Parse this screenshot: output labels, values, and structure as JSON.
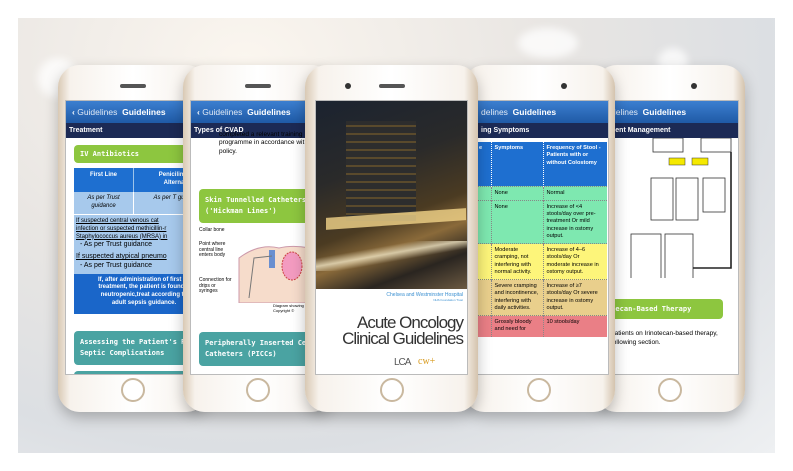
{
  "nav": {
    "back_label": "Guidelines",
    "title": "Guidelines"
  },
  "phone1": {
    "section": "Treatment",
    "heading": "IV Antibiotics",
    "table": {
      "headers": [
        "First Line",
        "Penicilin A",
        "Alterna"
      ],
      "row1": [
        "As per Trust guidance",
        "As per T guidar"
      ],
      "note1": [
        "If suspected central venous cat",
        "infection or suspected methicillin-r",
        "Staphylococcus aureus (MRSA) in"
      ],
      "note1_tail": "- As per Trust guidance",
      "note2": "If suspected atypical pneumo",
      "note2_tail": "- As per Trust guidance",
      "footer": [
        "If, after administration of first an",
        "treatment, the patient is found n",
        "neutropenic,treat according to",
        "adult sepsis guidance."
      ]
    },
    "next_section": [
      "Assessing the Patient's Risk",
      "Septic Complications"
    ]
  },
  "phone2": {
    "section": "Types of CVAD",
    "intro": [
      "completed a relevant training",
      "programme in accordance wit",
      "policy."
    ],
    "heading": [
      "Skin Tunnelled Catheters",
      "('Hickman Lines')"
    ],
    "diagram_labels": [
      "Collar bone",
      "Point where central line enters body",
      "Connection for drips or syringes"
    ],
    "caption": [
      "Diagram showing",
      "Copyright ©"
    ],
    "next_section": [
      "Peripherally Inserted Centr",
      "Catheters (PICCs)"
    ]
  },
  "phone3": {
    "hospital": "Chelsea and Westminster Hospital",
    "trust": "NHS Foundation Trust",
    "title_line1": "Acute Oncology",
    "title_line2": "Clinical Guidelines",
    "logo_lca": "LCA",
    "logo_cw": "cw+"
  },
  "phone4": {
    "nav_fragment": "delines",
    "section": "ing Symptoms",
    "headers": [
      "e",
      "Symptoms",
      "Frequency of Stool - Patients with or without Colostomy"
    ],
    "rows": [
      {
        "symptoms": "None",
        "frequency": "Normal",
        "color": "#7ee8b0"
      },
      {
        "symptoms": "None",
        "frequency": "Increase of <4 stools/day over pre-treatment Or mild increase in ostomy output.",
        "color": "#7ee8b0"
      },
      {
        "symptoms": "Moderate cramping, not interfering with normal activity.",
        "frequency": "Increase of 4–6 stools/day Or moderate increase in ostomy output.",
        "color": "#fdf57a"
      },
      {
        "symptoms": "Severe cramping and incontinence, interfering with daily activities.",
        "frequency": "Increase of ≥7 stools/day Or severe increase in ostomy output.",
        "color": "#e9cf8c"
      },
      {
        "symptoms": "Grossly bloody and need for",
        "frequency": "10 stools/day",
        "color": "#ea7f86"
      }
    ]
  },
  "phone5": {
    "nav_fragment": "delines",
    "section": "uent Management",
    "heading": "otecan-Based Therapy",
    "body": [
      "patients on Irinotecan-based therapy,",
      "following section."
    ]
  },
  "colors": {
    "header_blue": "#2a6bbd",
    "navy": "#1c2a55",
    "green": "#8dc63f",
    "teal": "#4aa3a2",
    "table_blue": "#1e6fd0",
    "table_light": "#a7c9ec"
  }
}
